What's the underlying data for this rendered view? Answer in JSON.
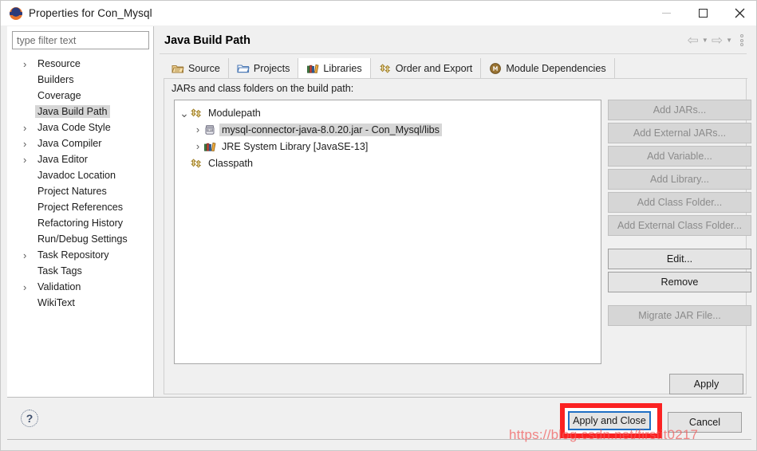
{
  "window": {
    "title": "Properties for Con_Mysql",
    "app_icon": "eclipse-icon",
    "minimize_label": "Minimize",
    "maximize_label": "Maximize",
    "close_label": "Close"
  },
  "sidebar": {
    "filter": {
      "value": "",
      "placeholder": "type filter text"
    },
    "items": [
      {
        "label": "Resource",
        "expandable": true,
        "selected": false
      },
      {
        "label": "Builders",
        "expandable": false,
        "selected": false
      },
      {
        "label": "Coverage",
        "expandable": false,
        "selected": false
      },
      {
        "label": "Java Build Path",
        "expandable": false,
        "selected": true
      },
      {
        "label": "Java Code Style",
        "expandable": true,
        "selected": false
      },
      {
        "label": "Java Compiler",
        "expandable": true,
        "selected": false
      },
      {
        "label": "Java Editor",
        "expandable": true,
        "selected": false
      },
      {
        "label": "Javadoc Location",
        "expandable": false,
        "selected": false
      },
      {
        "label": "Project Natures",
        "expandable": false,
        "selected": false
      },
      {
        "label": "Project References",
        "expandable": false,
        "selected": false
      },
      {
        "label": "Refactoring History",
        "expandable": false,
        "selected": false
      },
      {
        "label": "Run/Debug Settings",
        "expandable": false,
        "selected": false
      },
      {
        "label": "Task Repository",
        "expandable": true,
        "selected": false
      },
      {
        "label": "Task Tags",
        "expandable": false,
        "selected": false
      },
      {
        "label": "Validation",
        "expandable": true,
        "selected": false
      },
      {
        "label": "WikiText",
        "expandable": false,
        "selected": false
      }
    ]
  },
  "content": {
    "page_title": "Java Build Path",
    "nav": {
      "back_label": "Back",
      "forward_label": "Forward",
      "menu_label": "View Menu"
    },
    "tabs": [
      {
        "label": "Source",
        "icon": "source-folder-icon",
        "active": false
      },
      {
        "label": "Projects",
        "icon": "projects-folder-icon",
        "active": false
      },
      {
        "label": "Libraries",
        "icon": "libraries-books-icon",
        "active": true
      },
      {
        "label": "Order and Export",
        "icon": "modulepath-icon",
        "active": false
      },
      {
        "label": "Module Dependencies",
        "icon": "module-circle-icon",
        "active": false
      }
    ],
    "jars_label": "JARs and class folders on the build path:",
    "tree": [
      {
        "label": "Modulepath",
        "icon": "modulepath-icon",
        "indent": 0,
        "twisty": "expanded",
        "selected": false
      },
      {
        "label": "mysql-connector-java-8.0.20.jar - Con_Mysql/libs",
        "icon": "jar-icon",
        "indent": 1,
        "twisty": "collapsed",
        "selected": true
      },
      {
        "label": "JRE System Library [JavaSE-13]",
        "icon": "libraries-books-icon",
        "indent": 1,
        "twisty": "collapsed",
        "selected": false
      },
      {
        "label": "Classpath",
        "icon": "modulepath-icon",
        "indent": 0,
        "twisty": "none",
        "selected": false
      }
    ],
    "side_buttons": [
      {
        "label": "Add JARs...",
        "enabled": false,
        "gap": false
      },
      {
        "label": "Add External JARs...",
        "enabled": false,
        "gap": false
      },
      {
        "label": "Add Variable...",
        "enabled": false,
        "gap": false
      },
      {
        "label": "Add Library...",
        "enabled": false,
        "gap": false
      },
      {
        "label": "Add Class Folder...",
        "enabled": false,
        "gap": false
      },
      {
        "label": "Add External Class Folder...",
        "enabled": false,
        "gap": false
      },
      {
        "label": "Edit...",
        "enabled": true,
        "gap": true
      },
      {
        "label": "Remove",
        "enabled": true,
        "gap": false
      },
      {
        "label": "Migrate JAR File...",
        "enabled": false,
        "gap": true
      }
    ],
    "apply_label": "Apply"
  },
  "footer": {
    "help_label": "?",
    "apply_and_close_label": "Apply and Close",
    "cancel_label": "Cancel",
    "watermark": "https://blog.csdn.net/firstit0217"
  },
  "colors": {
    "highlight_red": "#fb2222",
    "focus_blue": "#1f6fc4",
    "selection_gray": "#d6d6d6",
    "panel_gray": "#f0f0f0"
  }
}
